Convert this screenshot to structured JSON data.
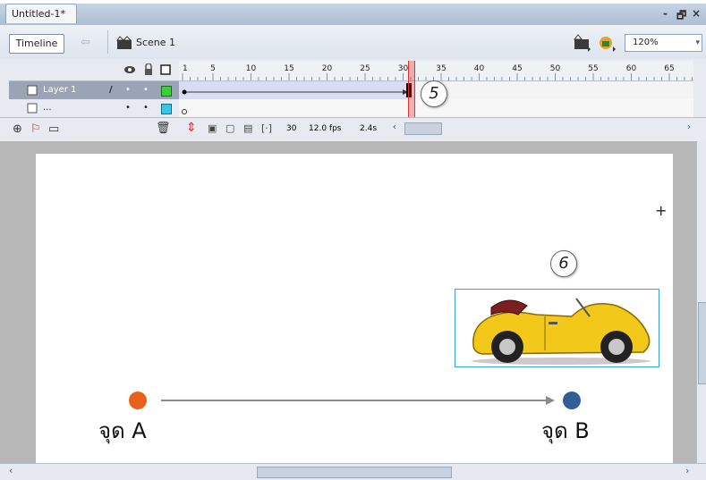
{
  "document_tab": "Untitled-1*",
  "window_controls": {
    "minimize": "-",
    "restore": "🗗",
    "close": "×"
  },
  "toolbar": {
    "timeline_label": "Timeline",
    "scene_label": "Scene 1",
    "zoom_value": "120%"
  },
  "timeline": {
    "ruler_ticks": [
      "1",
      "5",
      "10",
      "15",
      "20",
      "25",
      "30",
      "35",
      "40",
      "45",
      "50",
      "55",
      "60",
      "65"
    ],
    "layers": [
      {
        "name": "Layer 1"
      },
      {
        "name": "..."
      }
    ],
    "status": {
      "frame": "30",
      "fps": "12.0 fps",
      "time": "2.4s"
    }
  },
  "callouts": {
    "frame_marker": "5",
    "car_marker": "6"
  },
  "stage": {
    "point_a_label": "จุด A",
    "point_b_label": "จุด B",
    "crosshair": "+"
  },
  "colors": {
    "point_a": "#e8611a",
    "point_b": "#2f5f96",
    "arrow": "#8a8a8a",
    "playhead": "#e03030"
  }
}
